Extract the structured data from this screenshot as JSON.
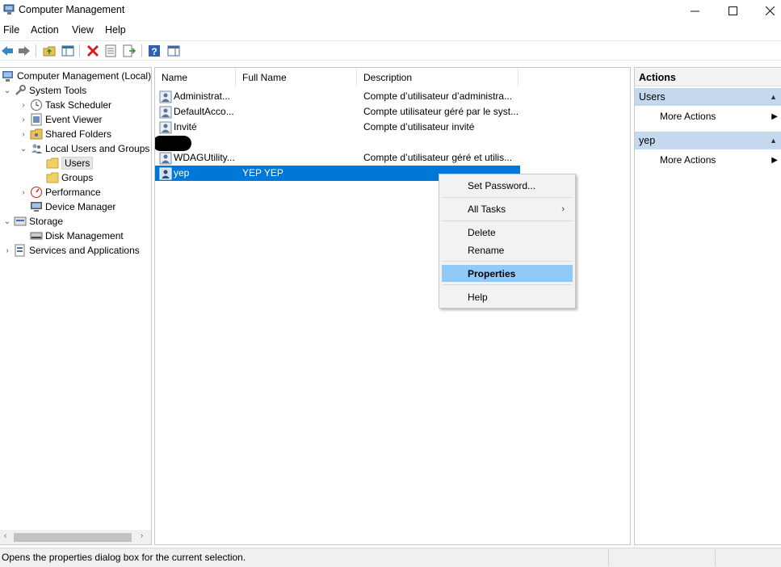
{
  "window": {
    "title": "Computer Management"
  },
  "menu": [
    "File",
    "Action",
    "View",
    "Help"
  ],
  "toolbar_icons": [
    "back-arrow-icon",
    "forward-arrow-icon",
    "up-folder-icon",
    "show-hide-console-tree-icon",
    "delete-icon",
    "properties-icon",
    "export-list-icon",
    "help-icon",
    "show-hide-action-pane-icon"
  ],
  "tree": {
    "root": "Computer Management (Local)",
    "system_tools": "System Tools",
    "task_scheduler": "Task Scheduler",
    "event_viewer": "Event Viewer",
    "shared_folders": "Shared Folders",
    "local_users_groups": "Local Users and Groups",
    "users": "Users",
    "groups": "Groups",
    "performance": "Performance",
    "device_manager": "Device Manager",
    "storage": "Storage",
    "disk_management": "Disk Management",
    "services_apps": "Services and Applications"
  },
  "list": {
    "columns": [
      "Name",
      "Full Name",
      "Description"
    ],
    "rows": [
      {
        "name": "Administrat...",
        "full_name": "",
        "description": "Compte d’utilisateur d’administra..."
      },
      {
        "name": "DefaultAcco...",
        "full_name": "",
        "description": "Compte utilisateur géré par le syst..."
      },
      {
        "name": "Invité",
        "full_name": "",
        "description": "Compte d’utilisateur invité"
      },
      {
        "name": "",
        "full_name": "",
        "description": ""
      },
      {
        "name": "WDAGUtility...",
        "full_name": "",
        "description": "Compte d’utilisateur géré et utilis..."
      },
      {
        "name": "yep",
        "full_name": "YEP YEP",
        "description": ""
      }
    ]
  },
  "context_menu": {
    "set_password": "Set Password...",
    "all_tasks": "All Tasks",
    "delete": "Delete",
    "rename": "Rename",
    "properties": "Properties",
    "help": "Help"
  },
  "actions": {
    "header": "Actions",
    "section1": "Users",
    "section1_more": "More Actions",
    "section2": "yep",
    "section2_more": "More Actions"
  },
  "status": {
    "text": "Opens the properties dialog box for the current selection."
  },
  "colors": {
    "selection": "#0078d7",
    "menu_highlight": "#91c9f7",
    "action_section": "#c5d9ee"
  }
}
